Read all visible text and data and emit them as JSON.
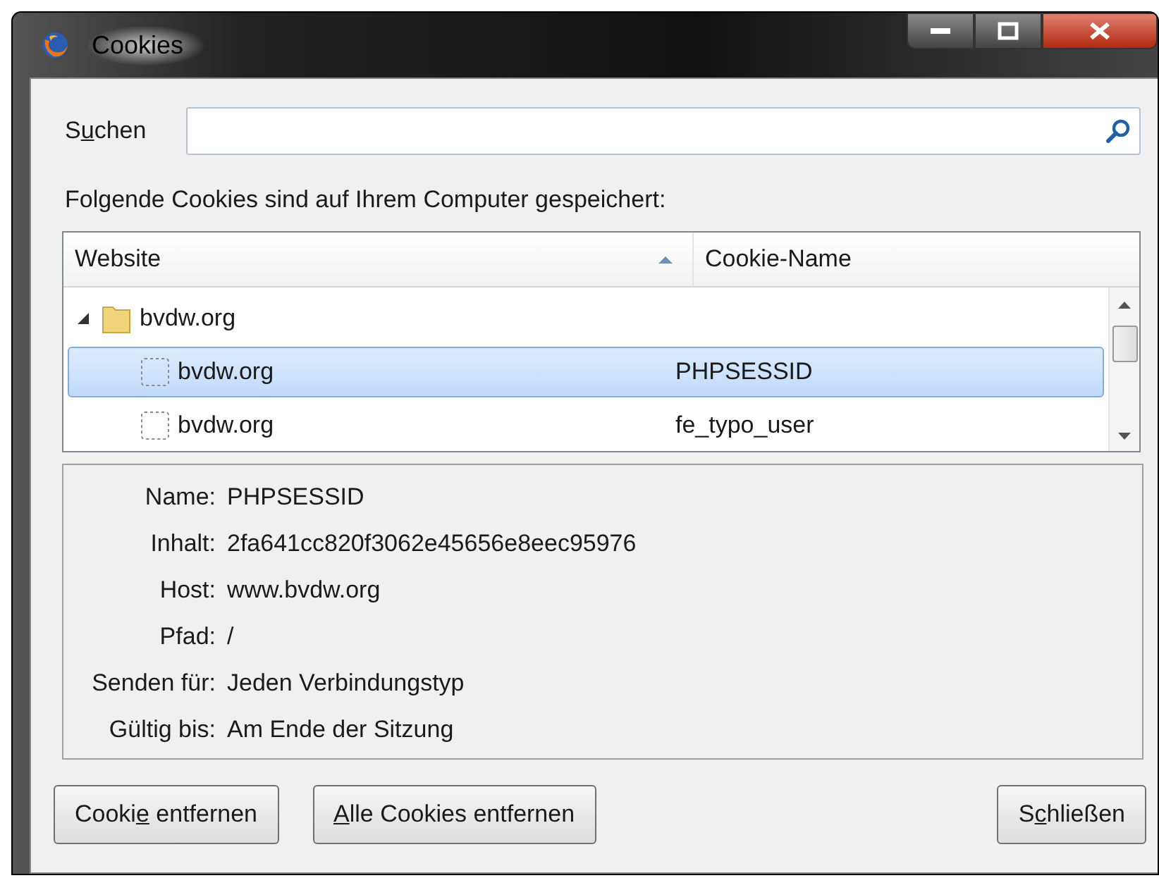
{
  "window": {
    "title": "Cookies"
  },
  "search": {
    "label": {
      "before": "S",
      "key": "u",
      "after": "chen"
    }
  },
  "intro": "Folgende Cookies sind auf Ihrem Computer gespeichert:",
  "tree": {
    "columns": [
      {
        "label": "Website",
        "sorted": true
      },
      {
        "label": "Cookie-Name",
        "sorted": false
      }
    ],
    "rows": [
      {
        "kind": "folder",
        "website": "bvdw.org",
        "expanded": true,
        "selected": false,
        "children": [
          {
            "kind": "cookie",
            "website": "bvdw.org",
            "cookie_name": "PHPSESSID",
            "selected": true
          },
          {
            "kind": "cookie",
            "website": "bvdw.org",
            "cookie_name": "fe_typo_user",
            "selected": false
          }
        ]
      }
    ]
  },
  "details": [
    {
      "label": "Name:",
      "value": "PHPSESSID"
    },
    {
      "label": "Inhalt:",
      "value": "2fa641cc820f3062e45656e8eec95976"
    },
    {
      "label": "Host:",
      "value": "www.bvdw.org"
    },
    {
      "label": "Pfad:",
      "value": "/"
    },
    {
      "label": "Senden für:",
      "value": "Jeden Verbindungstyp"
    },
    {
      "label": "Gültig bis:",
      "value": "Am Ende der Sitzung"
    }
  ],
  "buttons": [
    {
      "before": "Cooki",
      "key": "e",
      "after": " entfernen",
      "kind": "remove"
    },
    {
      "key": "A",
      "after": "lle Cookies entfernen",
      "kind": "remove"
    },
    {
      "before": "S",
      "key": "c",
      "after": "hließen",
      "kind": "close"
    }
  ]
}
